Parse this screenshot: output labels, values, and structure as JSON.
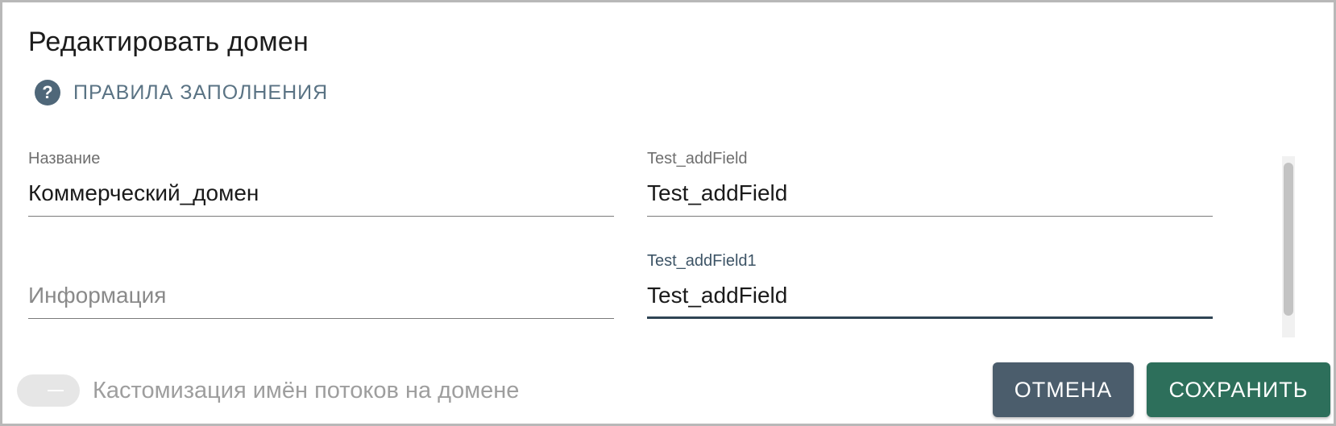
{
  "dialog": {
    "title": "Редактировать домен",
    "rules_link": {
      "icon": "help-circle-icon",
      "label": "ПРАВИЛА ЗАПОЛНЕНИЯ"
    }
  },
  "fields": {
    "name": {
      "label": "Название",
      "value": "Коммерческий_домен"
    },
    "info": {
      "placeholder": "Информация",
      "value": ""
    },
    "add_field": {
      "label": "Test_addField",
      "value": "Test_addField"
    },
    "add_field1": {
      "label": "Test_addField1",
      "value": "Test_addField"
    }
  },
  "toggle": {
    "label": "Кастомизация имён потоков на домене",
    "checked": false,
    "disabled": true
  },
  "buttons": {
    "cancel": "ОТМЕНА",
    "save": "СОХРАНИТЬ"
  },
  "colors": {
    "cancel_bg": "#4b5d6c",
    "save_bg": "#2d6f5b",
    "accent": "#4f6779"
  }
}
